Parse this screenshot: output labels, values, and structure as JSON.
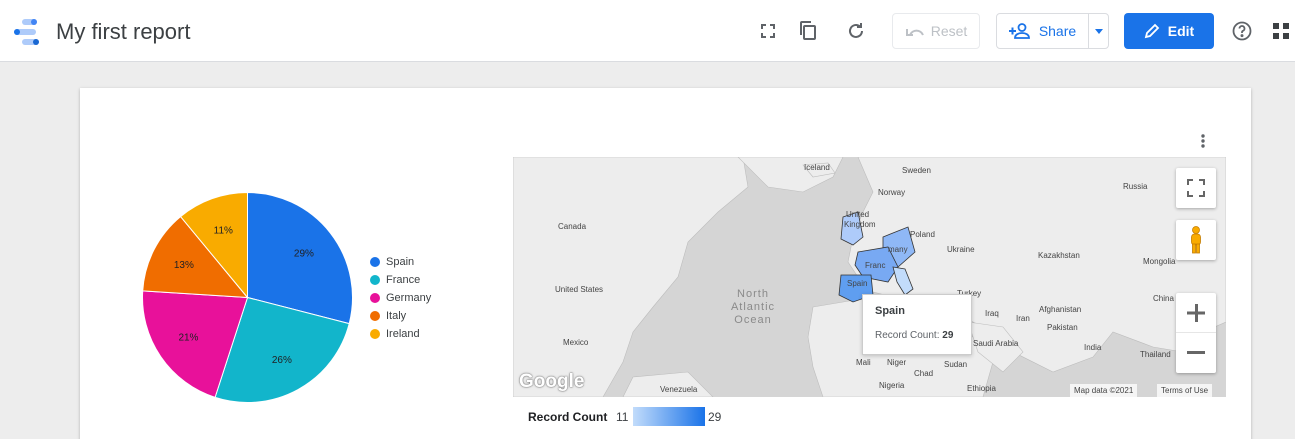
{
  "app": {
    "title": "My first report"
  },
  "toolbar": {
    "reset_label": "Reset",
    "share_label": "Share",
    "edit_label": "Edit"
  },
  "pie": {
    "legend": [
      {
        "label": "Spain",
        "color": "#1a73e8"
      },
      {
        "label": "France",
        "color": "#12b5cb"
      },
      {
        "label": "Germany",
        "color": "#e8119a"
      },
      {
        "label": "Italy",
        "color": "#f06d00"
      },
      {
        "label": "Ireland",
        "color": "#f9ab00"
      }
    ]
  },
  "chart_data": {
    "type": "pie",
    "categories": [
      "Spain",
      "France",
      "Germany",
      "Italy",
      "Ireland"
    ],
    "values": [
      29,
      26,
      21,
      13,
      11
    ],
    "value_labels": [
      "29%",
      "26%",
      "21%",
      "13%",
      "11%"
    ],
    "legend_position": "right"
  },
  "map": {
    "labels": {
      "iceland": "Iceland",
      "sweden": "Sweden",
      "norway": "Norway",
      "russia": "Russia",
      "canada": "Canada",
      "united_kingdom_1": "United",
      "united_kingdom_2": "Kingdom",
      "poland": "Poland",
      "ukraine": "Ukraine",
      "kazakhstan": "Kazakhstan",
      "germany": "many",
      "france": "Franc",
      "mongolia": "Mongolia",
      "united_states": "United States",
      "ocean_1": "North",
      "ocean_2": "Atlantic",
      "ocean_3": "Ocean",
      "spain": "Spain",
      "turkey": "Turkey",
      "afghanistan": "Afghanistan",
      "iraq": "Iraq",
      "iran": "Iran",
      "pakistan": "Pakistan",
      "china": "China",
      "mexico": "Mexico",
      "saudi_arabia": "Saudi Arabia",
      "india": "India",
      "mali": "Mali",
      "niger": "Niger",
      "sudan": "Sudan",
      "thailand": "Thailand",
      "chad": "Chad",
      "venezuela": "Venezuela",
      "nigeria": "Nigeria",
      "ethiopia": "Ethiopia"
    },
    "tooltip": {
      "title": "Spain",
      "metric_label": "Record Count: ",
      "metric_value": "29"
    },
    "google_logo": "Google",
    "map_data": "Map data ©2021",
    "terms": "Terms of Use"
  },
  "color_scale": {
    "label": "Record Count",
    "min": "11",
    "max": "29",
    "min_color": "#c2dcfb",
    "max_color": "#1a73e8"
  }
}
